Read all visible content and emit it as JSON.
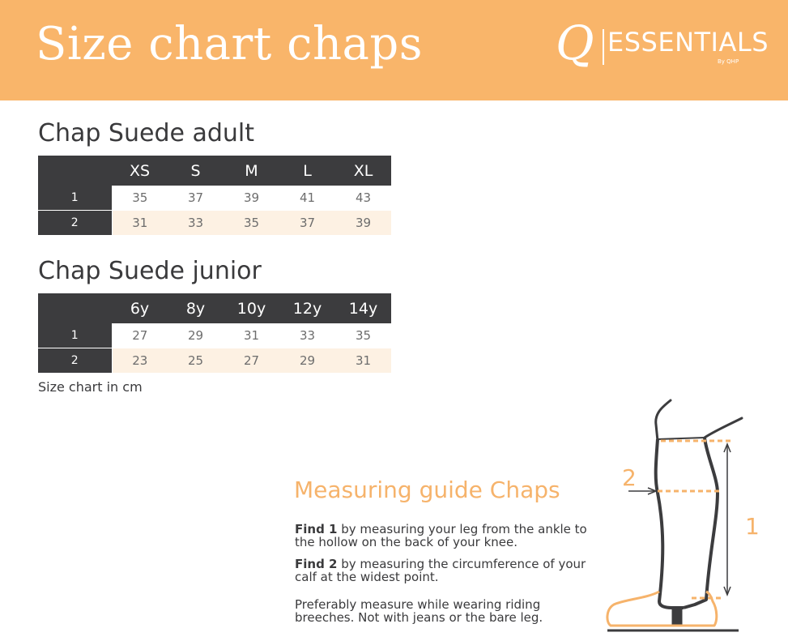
{
  "banner": {
    "title": "Size chart chaps",
    "logo": {
      "q": "Q",
      "word": "ESSENTIALS",
      "sub": "By QHP"
    }
  },
  "adult": {
    "title": "Chap Suede adult",
    "headers": [
      "",
      "XS",
      "S",
      "M",
      "L",
      "XL"
    ],
    "rows": [
      {
        "label": "1",
        "values": [
          "35",
          "37",
          "39",
          "41",
          "43"
        ]
      },
      {
        "label": "2",
        "values": [
          "31",
          "33",
          "35",
          "37",
          "39"
        ]
      }
    ]
  },
  "junior": {
    "title": "Chap Suede junior",
    "headers": [
      "",
      "6y",
      "8y",
      "10y",
      "12y",
      "14y"
    ],
    "rows": [
      {
        "label": "1",
        "values": [
          "27",
          "29",
          "31",
          "33",
          "35"
        ]
      },
      {
        "label": "2",
        "values": [
          "23",
          "25",
          "27",
          "29",
          "31"
        ]
      }
    ]
  },
  "footnote": "Size chart in cm",
  "guide": {
    "title": "Measuring guide Chaps",
    "find1_bold": "Find 1",
    "find1_text": " by measuring your leg from the ankle to the hollow on the back of your knee.",
    "find2_bold": "Find 2",
    "find2_text": " by measuring the circumference of your calf at the widest point.",
    "note": "Preferably measure while wearing riding breeches. Not with jeans or the bare leg."
  },
  "diagram": {
    "label1": "1",
    "label2": "2"
  },
  "colors": {
    "banner": "#f9b56a",
    "accent": "#f6b36b",
    "table_header": "#3c3c3e",
    "row_tint": "#fdf1e3"
  }
}
